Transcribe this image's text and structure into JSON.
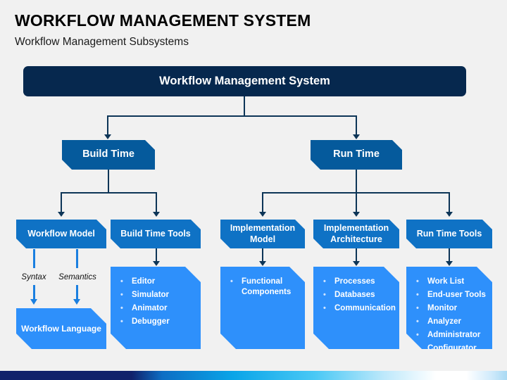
{
  "slide": {
    "title": "WORKFLOW MANAGEMENT SYSTEM",
    "subtitle": "Workflow Management Subsystems"
  },
  "colors": {
    "background": "#f1f1f1",
    "root": "#06284e",
    "level2": "#055a9c",
    "level3": "#0f72c5",
    "leaf": "#2e90fb",
    "connector": "#0d3557",
    "accent_arrow": "#1a7fe0"
  },
  "diagram": {
    "root": {
      "label": "Workflow Management System"
    },
    "branches": [
      {
        "label": "Build Time"
      },
      {
        "label": "Run Time"
      }
    ],
    "categories": [
      {
        "label": "Workflow Model"
      },
      {
        "label": "Build Time Tools"
      },
      {
        "label": "Implementation Model"
      },
      {
        "label": "Implementation Architecture"
      },
      {
        "label": "Run Time Tools"
      }
    ],
    "edge_labels": [
      {
        "label": "Syntax"
      },
      {
        "label": "Semantics"
      }
    ],
    "workflow_language": {
      "label": "Workflow Language"
    },
    "lists": {
      "build_time_tools": [
        "Editor",
        "Simulator",
        "Animator",
        "Debugger"
      ],
      "implementation_model": [
        "Functional Components"
      ],
      "implementation_architecture": [
        "Processes",
        "Databases",
        "Communication"
      ],
      "run_time_tools": [
        "Work List",
        "End-user Tools",
        "Monitor",
        "Analyzer",
        "Administrator",
        "Configurator"
      ]
    },
    "bullet_glyph": "•"
  }
}
